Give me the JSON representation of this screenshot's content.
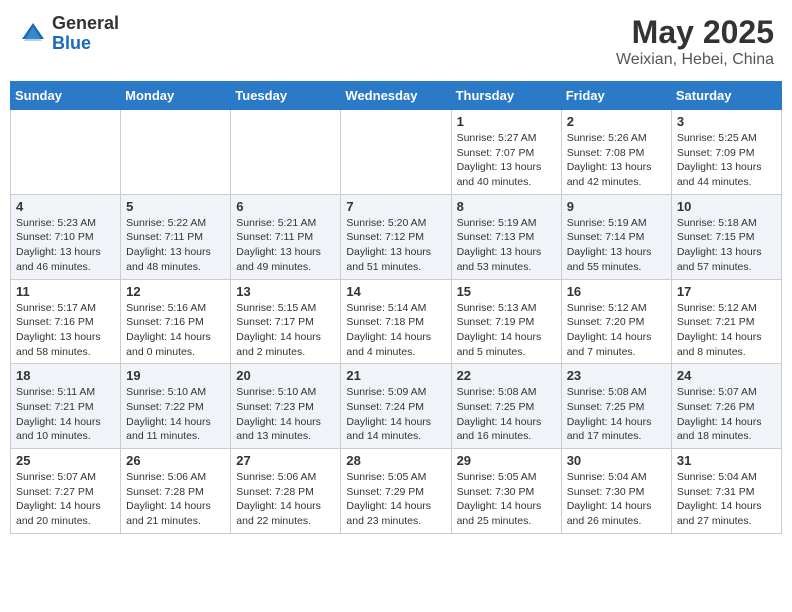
{
  "header": {
    "logo_general": "General",
    "logo_blue": "Blue",
    "month_title": "May 2025",
    "location": "Weixian, Hebei, China"
  },
  "weekdays": [
    "Sunday",
    "Monday",
    "Tuesday",
    "Wednesday",
    "Thursday",
    "Friday",
    "Saturday"
  ],
  "weeks": [
    [
      {
        "day": "",
        "sunrise": "",
        "sunset": "",
        "daylight": ""
      },
      {
        "day": "",
        "sunrise": "",
        "sunset": "",
        "daylight": ""
      },
      {
        "day": "",
        "sunrise": "",
        "sunset": "",
        "daylight": ""
      },
      {
        "day": "",
        "sunrise": "",
        "sunset": "",
        "daylight": ""
      },
      {
        "day": "1",
        "sunrise": "Sunrise: 5:27 AM",
        "sunset": "Sunset: 7:07 PM",
        "daylight": "Daylight: 13 hours and 40 minutes."
      },
      {
        "day": "2",
        "sunrise": "Sunrise: 5:26 AM",
        "sunset": "Sunset: 7:08 PM",
        "daylight": "Daylight: 13 hours and 42 minutes."
      },
      {
        "day": "3",
        "sunrise": "Sunrise: 5:25 AM",
        "sunset": "Sunset: 7:09 PM",
        "daylight": "Daylight: 13 hours and 44 minutes."
      }
    ],
    [
      {
        "day": "4",
        "sunrise": "Sunrise: 5:23 AM",
        "sunset": "Sunset: 7:10 PM",
        "daylight": "Daylight: 13 hours and 46 minutes."
      },
      {
        "day": "5",
        "sunrise": "Sunrise: 5:22 AM",
        "sunset": "Sunset: 7:11 PM",
        "daylight": "Daylight: 13 hours and 48 minutes."
      },
      {
        "day": "6",
        "sunrise": "Sunrise: 5:21 AM",
        "sunset": "Sunset: 7:11 PM",
        "daylight": "Daylight: 13 hours and 49 minutes."
      },
      {
        "day": "7",
        "sunrise": "Sunrise: 5:20 AM",
        "sunset": "Sunset: 7:12 PM",
        "daylight": "Daylight: 13 hours and 51 minutes."
      },
      {
        "day": "8",
        "sunrise": "Sunrise: 5:19 AM",
        "sunset": "Sunset: 7:13 PM",
        "daylight": "Daylight: 13 hours and 53 minutes."
      },
      {
        "day": "9",
        "sunrise": "Sunrise: 5:19 AM",
        "sunset": "Sunset: 7:14 PM",
        "daylight": "Daylight: 13 hours and 55 minutes."
      },
      {
        "day": "10",
        "sunrise": "Sunrise: 5:18 AM",
        "sunset": "Sunset: 7:15 PM",
        "daylight": "Daylight: 13 hours and 57 minutes."
      }
    ],
    [
      {
        "day": "11",
        "sunrise": "Sunrise: 5:17 AM",
        "sunset": "Sunset: 7:16 PM",
        "daylight": "Daylight: 13 hours and 58 minutes."
      },
      {
        "day": "12",
        "sunrise": "Sunrise: 5:16 AM",
        "sunset": "Sunset: 7:16 PM",
        "daylight": "Daylight: 14 hours and 0 minutes."
      },
      {
        "day": "13",
        "sunrise": "Sunrise: 5:15 AM",
        "sunset": "Sunset: 7:17 PM",
        "daylight": "Daylight: 14 hours and 2 minutes."
      },
      {
        "day": "14",
        "sunrise": "Sunrise: 5:14 AM",
        "sunset": "Sunset: 7:18 PM",
        "daylight": "Daylight: 14 hours and 4 minutes."
      },
      {
        "day": "15",
        "sunrise": "Sunrise: 5:13 AM",
        "sunset": "Sunset: 7:19 PM",
        "daylight": "Daylight: 14 hours and 5 minutes."
      },
      {
        "day": "16",
        "sunrise": "Sunrise: 5:12 AM",
        "sunset": "Sunset: 7:20 PM",
        "daylight": "Daylight: 14 hours and 7 minutes."
      },
      {
        "day": "17",
        "sunrise": "Sunrise: 5:12 AM",
        "sunset": "Sunset: 7:21 PM",
        "daylight": "Daylight: 14 hours and 8 minutes."
      }
    ],
    [
      {
        "day": "18",
        "sunrise": "Sunrise: 5:11 AM",
        "sunset": "Sunset: 7:21 PM",
        "daylight": "Daylight: 14 hours and 10 minutes."
      },
      {
        "day": "19",
        "sunrise": "Sunrise: 5:10 AM",
        "sunset": "Sunset: 7:22 PM",
        "daylight": "Daylight: 14 hours and 11 minutes."
      },
      {
        "day": "20",
        "sunrise": "Sunrise: 5:10 AM",
        "sunset": "Sunset: 7:23 PM",
        "daylight": "Daylight: 14 hours and 13 minutes."
      },
      {
        "day": "21",
        "sunrise": "Sunrise: 5:09 AM",
        "sunset": "Sunset: 7:24 PM",
        "daylight": "Daylight: 14 hours and 14 minutes."
      },
      {
        "day": "22",
        "sunrise": "Sunrise: 5:08 AM",
        "sunset": "Sunset: 7:25 PM",
        "daylight": "Daylight: 14 hours and 16 minutes."
      },
      {
        "day": "23",
        "sunrise": "Sunrise: 5:08 AM",
        "sunset": "Sunset: 7:25 PM",
        "daylight": "Daylight: 14 hours and 17 minutes."
      },
      {
        "day": "24",
        "sunrise": "Sunrise: 5:07 AM",
        "sunset": "Sunset: 7:26 PM",
        "daylight": "Daylight: 14 hours and 18 minutes."
      }
    ],
    [
      {
        "day": "25",
        "sunrise": "Sunrise: 5:07 AM",
        "sunset": "Sunset: 7:27 PM",
        "daylight": "Daylight: 14 hours and 20 minutes."
      },
      {
        "day": "26",
        "sunrise": "Sunrise: 5:06 AM",
        "sunset": "Sunset: 7:28 PM",
        "daylight": "Daylight: 14 hours and 21 minutes."
      },
      {
        "day": "27",
        "sunrise": "Sunrise: 5:06 AM",
        "sunset": "Sunset: 7:28 PM",
        "daylight": "Daylight: 14 hours and 22 minutes."
      },
      {
        "day": "28",
        "sunrise": "Sunrise: 5:05 AM",
        "sunset": "Sunset: 7:29 PM",
        "daylight": "Daylight: 14 hours and 23 minutes."
      },
      {
        "day": "29",
        "sunrise": "Sunrise: 5:05 AM",
        "sunset": "Sunset: 7:30 PM",
        "daylight": "Daylight: 14 hours and 25 minutes."
      },
      {
        "day": "30",
        "sunrise": "Sunrise: 5:04 AM",
        "sunset": "Sunset: 7:30 PM",
        "daylight": "Daylight: 14 hours and 26 minutes."
      },
      {
        "day": "31",
        "sunrise": "Sunrise: 5:04 AM",
        "sunset": "Sunset: 7:31 PM",
        "daylight": "Daylight: 14 hours and 27 minutes."
      }
    ]
  ]
}
